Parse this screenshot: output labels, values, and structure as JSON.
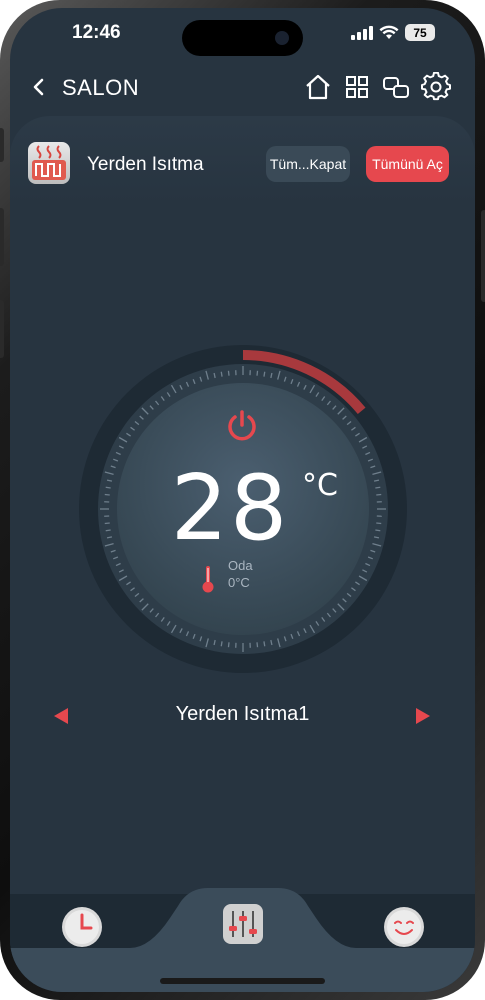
{
  "status_bar": {
    "time": "12:46",
    "battery": "75"
  },
  "header": {
    "title": "SALON",
    "icons": [
      "back-icon",
      "home-icon",
      "grid-icon",
      "scenes-icon",
      "settings-icon"
    ]
  },
  "device": {
    "name": "Yerden Isıtma",
    "off_all_label": "Tüm...Kapat",
    "on_all_label": "Tümünü Aç"
  },
  "thermostat": {
    "set_temperature": "28",
    "unit": "°C",
    "room_label": "Oda",
    "room_temperature": "0°C",
    "power_color": "#e6484e",
    "level_fraction": 0.14
  },
  "zone": {
    "name": "Yerden Isıtma1"
  },
  "tabs": [
    {
      "name": "schedule-clock-icon",
      "active": false
    },
    {
      "name": "control-sliders-icon",
      "active": true
    },
    {
      "name": "comfort-face-icon",
      "active": false
    }
  ],
  "colors": {
    "background": "#273440",
    "accent": "#e6484e",
    "secondary_button": "#3a4a57"
  }
}
